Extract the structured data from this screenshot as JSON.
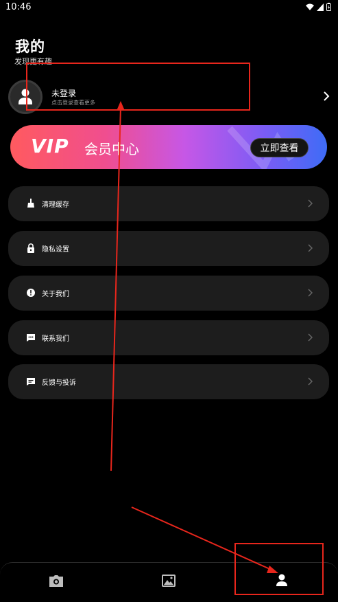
{
  "status_bar": {
    "time": "10:46"
  },
  "header": {
    "title": "我的",
    "subtitle": "发现更有趣"
  },
  "profile": {
    "name": "未登录",
    "hint": "点击登录查看更多"
  },
  "vip": {
    "logo": "VIP",
    "title": "会员中心",
    "button_label": "立即查看"
  },
  "menu": [
    {
      "label": "清理缓存",
      "icon": "broom-icon"
    },
    {
      "label": "隐私设置",
      "icon": "lock-icon"
    },
    {
      "label": "关于我们",
      "icon": "info-icon"
    },
    {
      "label": "联系我们",
      "icon": "chat-icon"
    },
    {
      "label": "反馈与投诉",
      "icon": "feedback-icon"
    }
  ],
  "bottom_nav": [
    {
      "icon": "camera-icon",
      "active": false
    },
    {
      "icon": "image-icon",
      "active": false
    },
    {
      "icon": "user-icon",
      "active": true
    }
  ],
  "colors": {
    "background": "#000000",
    "card": "#1d1d1d",
    "annotation": "#e8261c",
    "vip_start": "#ff5a5f",
    "vip_end": "#3e6cf6"
  }
}
